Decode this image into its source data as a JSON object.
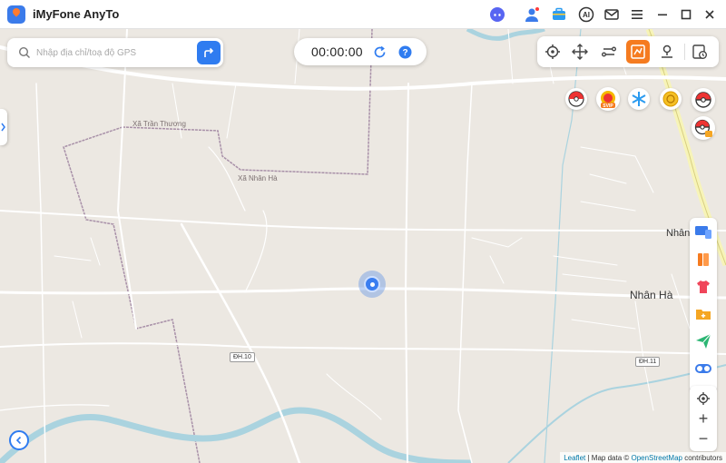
{
  "app": {
    "title": "iMyFone AnyTo"
  },
  "colors": {
    "accent": "#2f7cf0",
    "active_mode": "#f57b20",
    "map_bg": "#ece8e2",
    "boundary": "#a890a8"
  },
  "title_bar_icons": [
    "discord-icon",
    "account-icon",
    "toolbox-icon",
    "ai-icon",
    "mail-icon",
    "menu-icon",
    "minimize-icon",
    "maximize-icon",
    "close-icon"
  ],
  "search": {
    "placeholder": "Nhập địa chỉ/toạ độ GPS",
    "value": ""
  },
  "timer": {
    "value": "00:00:00"
  },
  "mode_toolbar": [
    "teleport-mode-icon",
    "joystick-mode-icon",
    "two-spot-mode-icon",
    "multi-spot-mode-icon",
    "jump-teleport-mode-icon",
    "history-icon"
  ],
  "game_badges": {
    "svip_label": "SVIP"
  },
  "map": {
    "labels": {
      "xa_tran_thuong": "Xã Trần Thương",
      "xa_nhan_ha": "Xã Nhân Hà",
      "nhan_ha": "Nhân Hà",
      "nhan_partial": "Nhân",
      "dh10": "ĐH.10",
      "dh11": "ĐH.11"
    }
  },
  "zoom": {
    "plus": "+",
    "minus": "−"
  },
  "attribution": {
    "leaflet": "Leaflet",
    "separator": " | Map data © ",
    "osm": "OpenStreetMap",
    "suffix": " contributors"
  }
}
